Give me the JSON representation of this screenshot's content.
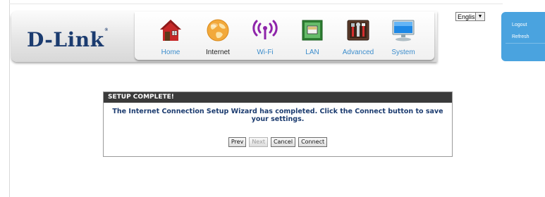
{
  "brand": {
    "logo_text": "D-Link",
    "registered_mark": "®"
  },
  "nav": {
    "items": [
      {
        "label": "Home",
        "icon": "home-icon"
      },
      {
        "label": "Internet",
        "icon": "globe-icon",
        "active": true
      },
      {
        "label": "Wi-Fi",
        "icon": "wifi-icon"
      },
      {
        "label": "LAN",
        "icon": "lan-icon"
      },
      {
        "label": "Advanced",
        "icon": "tools-icon"
      },
      {
        "label": "System",
        "icon": "computer-icon"
      }
    ]
  },
  "language": {
    "selected": "English"
  },
  "side": {
    "logout": "Logout",
    "refresh": "Refresh"
  },
  "dialog": {
    "title": "SETUP COMPLETE!",
    "message": "The Internet Connection Setup Wizard has completed. Click the Connect button to save your settings.",
    "buttons": {
      "prev": "Prev",
      "next": "Next",
      "cancel": "Cancel",
      "connect": "Connect"
    }
  },
  "colors": {
    "brand_blue": "#1b3b6f",
    "nav_label_blue": "#3c8dcc",
    "side_panel_blue": "#4aa3df",
    "dialog_header": "#3a3a3a"
  }
}
